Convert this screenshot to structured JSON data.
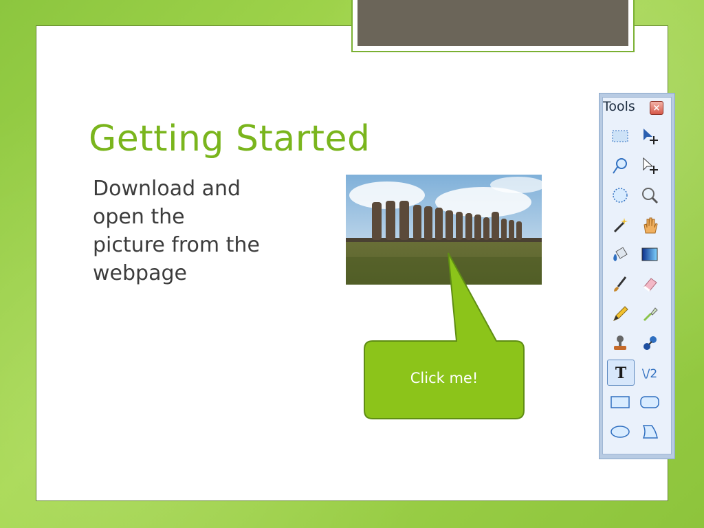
{
  "slide": {
    "title": "Getting Started",
    "body_lines": [
      "Download and",
      "open the",
      "picture from the",
      "webpage"
    ],
    "callout_text": "Click me!"
  },
  "tools_panel": {
    "title": "Tools",
    "close_icon": "close-icon",
    "tools": [
      {
        "name": "rectangle-select",
        "icon": "rectangle-select-icon"
      },
      {
        "name": "move-selection",
        "icon": "move-selection-icon"
      },
      {
        "name": "lasso-select",
        "icon": "lasso-select-icon"
      },
      {
        "name": "move-selection-outline",
        "icon": "move-selection-outline-icon"
      },
      {
        "name": "ellipse-select",
        "icon": "ellipse-select-icon"
      },
      {
        "name": "zoom",
        "icon": "zoom-icon"
      },
      {
        "name": "magic-wand",
        "icon": "magic-wand-icon"
      },
      {
        "name": "pan",
        "icon": "pan-icon"
      },
      {
        "name": "paint-bucket",
        "icon": "paint-bucket-icon"
      },
      {
        "name": "gradient",
        "icon": "gradient-icon"
      },
      {
        "name": "paintbrush",
        "icon": "paintbrush-icon"
      },
      {
        "name": "eraser",
        "icon": "eraser-icon"
      },
      {
        "name": "pencil",
        "icon": "pencil-icon"
      },
      {
        "name": "color-picker",
        "icon": "color-picker-icon"
      },
      {
        "name": "clone-stamp",
        "icon": "clone-stamp-icon"
      },
      {
        "name": "recolor",
        "icon": "recolor-icon"
      },
      {
        "name": "text",
        "icon": "text-icon",
        "active": true
      },
      {
        "name": "line-curve",
        "icon": "line-curve-icon"
      },
      {
        "name": "rectangle",
        "icon": "rectangle-icon"
      },
      {
        "name": "rounded-rectangle",
        "icon": "rounded-rectangle-icon"
      },
      {
        "name": "ellipse",
        "icon": "ellipse-icon"
      },
      {
        "name": "freeform-shape",
        "icon": "freeform-shape-icon"
      }
    ]
  },
  "colors": {
    "accent_green": "#7ab51d",
    "callout_fill": "#8cc41a",
    "body_text": "#3c3c3c"
  }
}
